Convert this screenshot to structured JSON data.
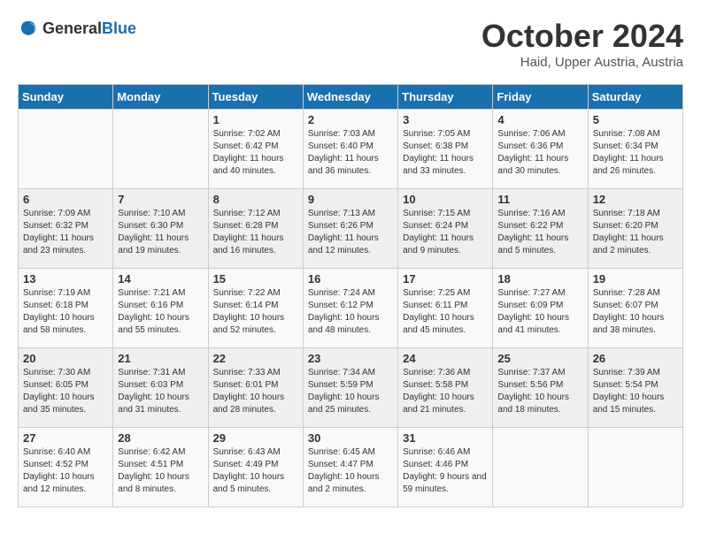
{
  "logo": {
    "general": "General",
    "blue": "Blue"
  },
  "header": {
    "month": "October 2024",
    "location": "Haid, Upper Austria, Austria"
  },
  "weekdays": [
    "Sunday",
    "Monday",
    "Tuesday",
    "Wednesday",
    "Thursday",
    "Friday",
    "Saturday"
  ],
  "weeks": [
    [
      {
        "day": "",
        "sunrise": "",
        "sunset": "",
        "daylight": ""
      },
      {
        "day": "",
        "sunrise": "",
        "sunset": "",
        "daylight": ""
      },
      {
        "day": "1",
        "sunrise": "Sunrise: 7:02 AM",
        "sunset": "Sunset: 6:42 PM",
        "daylight": "Daylight: 11 hours and 40 minutes."
      },
      {
        "day": "2",
        "sunrise": "Sunrise: 7:03 AM",
        "sunset": "Sunset: 6:40 PM",
        "daylight": "Daylight: 11 hours and 36 minutes."
      },
      {
        "day": "3",
        "sunrise": "Sunrise: 7:05 AM",
        "sunset": "Sunset: 6:38 PM",
        "daylight": "Daylight: 11 hours and 33 minutes."
      },
      {
        "day": "4",
        "sunrise": "Sunrise: 7:06 AM",
        "sunset": "Sunset: 6:36 PM",
        "daylight": "Daylight: 11 hours and 30 minutes."
      },
      {
        "day": "5",
        "sunrise": "Sunrise: 7:08 AM",
        "sunset": "Sunset: 6:34 PM",
        "daylight": "Daylight: 11 hours and 26 minutes."
      }
    ],
    [
      {
        "day": "6",
        "sunrise": "Sunrise: 7:09 AM",
        "sunset": "Sunset: 6:32 PM",
        "daylight": "Daylight: 11 hours and 23 minutes."
      },
      {
        "day": "7",
        "sunrise": "Sunrise: 7:10 AM",
        "sunset": "Sunset: 6:30 PM",
        "daylight": "Daylight: 11 hours and 19 minutes."
      },
      {
        "day": "8",
        "sunrise": "Sunrise: 7:12 AM",
        "sunset": "Sunset: 6:28 PM",
        "daylight": "Daylight: 11 hours and 16 minutes."
      },
      {
        "day": "9",
        "sunrise": "Sunrise: 7:13 AM",
        "sunset": "Sunset: 6:26 PM",
        "daylight": "Daylight: 11 hours and 12 minutes."
      },
      {
        "day": "10",
        "sunrise": "Sunrise: 7:15 AM",
        "sunset": "Sunset: 6:24 PM",
        "daylight": "Daylight: 11 hours and 9 minutes."
      },
      {
        "day": "11",
        "sunrise": "Sunrise: 7:16 AM",
        "sunset": "Sunset: 6:22 PM",
        "daylight": "Daylight: 11 hours and 5 minutes."
      },
      {
        "day": "12",
        "sunrise": "Sunrise: 7:18 AM",
        "sunset": "Sunset: 6:20 PM",
        "daylight": "Daylight: 11 hours and 2 minutes."
      }
    ],
    [
      {
        "day": "13",
        "sunrise": "Sunrise: 7:19 AM",
        "sunset": "Sunset: 6:18 PM",
        "daylight": "Daylight: 10 hours and 58 minutes."
      },
      {
        "day": "14",
        "sunrise": "Sunrise: 7:21 AM",
        "sunset": "Sunset: 6:16 PM",
        "daylight": "Daylight: 10 hours and 55 minutes."
      },
      {
        "day": "15",
        "sunrise": "Sunrise: 7:22 AM",
        "sunset": "Sunset: 6:14 PM",
        "daylight": "Daylight: 10 hours and 52 minutes."
      },
      {
        "day": "16",
        "sunrise": "Sunrise: 7:24 AM",
        "sunset": "Sunset: 6:12 PM",
        "daylight": "Daylight: 10 hours and 48 minutes."
      },
      {
        "day": "17",
        "sunrise": "Sunrise: 7:25 AM",
        "sunset": "Sunset: 6:11 PM",
        "daylight": "Daylight: 10 hours and 45 minutes."
      },
      {
        "day": "18",
        "sunrise": "Sunrise: 7:27 AM",
        "sunset": "Sunset: 6:09 PM",
        "daylight": "Daylight: 10 hours and 41 minutes."
      },
      {
        "day": "19",
        "sunrise": "Sunrise: 7:28 AM",
        "sunset": "Sunset: 6:07 PM",
        "daylight": "Daylight: 10 hours and 38 minutes."
      }
    ],
    [
      {
        "day": "20",
        "sunrise": "Sunrise: 7:30 AM",
        "sunset": "Sunset: 6:05 PM",
        "daylight": "Daylight: 10 hours and 35 minutes."
      },
      {
        "day": "21",
        "sunrise": "Sunrise: 7:31 AM",
        "sunset": "Sunset: 6:03 PM",
        "daylight": "Daylight: 10 hours and 31 minutes."
      },
      {
        "day": "22",
        "sunrise": "Sunrise: 7:33 AM",
        "sunset": "Sunset: 6:01 PM",
        "daylight": "Daylight: 10 hours and 28 minutes."
      },
      {
        "day": "23",
        "sunrise": "Sunrise: 7:34 AM",
        "sunset": "Sunset: 5:59 PM",
        "daylight": "Daylight: 10 hours and 25 minutes."
      },
      {
        "day": "24",
        "sunrise": "Sunrise: 7:36 AM",
        "sunset": "Sunset: 5:58 PM",
        "daylight": "Daylight: 10 hours and 21 minutes."
      },
      {
        "day": "25",
        "sunrise": "Sunrise: 7:37 AM",
        "sunset": "Sunset: 5:56 PM",
        "daylight": "Daylight: 10 hours and 18 minutes."
      },
      {
        "day": "26",
        "sunrise": "Sunrise: 7:39 AM",
        "sunset": "Sunset: 5:54 PM",
        "daylight": "Daylight: 10 hours and 15 minutes."
      }
    ],
    [
      {
        "day": "27",
        "sunrise": "Sunrise: 6:40 AM",
        "sunset": "Sunset: 4:52 PM",
        "daylight": "Daylight: 10 hours and 12 minutes."
      },
      {
        "day": "28",
        "sunrise": "Sunrise: 6:42 AM",
        "sunset": "Sunset: 4:51 PM",
        "daylight": "Daylight: 10 hours and 8 minutes."
      },
      {
        "day": "29",
        "sunrise": "Sunrise: 6:43 AM",
        "sunset": "Sunset: 4:49 PM",
        "daylight": "Daylight: 10 hours and 5 minutes."
      },
      {
        "day": "30",
        "sunrise": "Sunrise: 6:45 AM",
        "sunset": "Sunset: 4:47 PM",
        "daylight": "Daylight: 10 hours and 2 minutes."
      },
      {
        "day": "31",
        "sunrise": "Sunrise: 6:46 AM",
        "sunset": "Sunset: 4:46 PM",
        "daylight": "Daylight: 9 hours and 59 minutes."
      },
      {
        "day": "",
        "sunrise": "",
        "sunset": "",
        "daylight": ""
      },
      {
        "day": "",
        "sunrise": "",
        "sunset": "",
        "daylight": ""
      }
    ]
  ]
}
